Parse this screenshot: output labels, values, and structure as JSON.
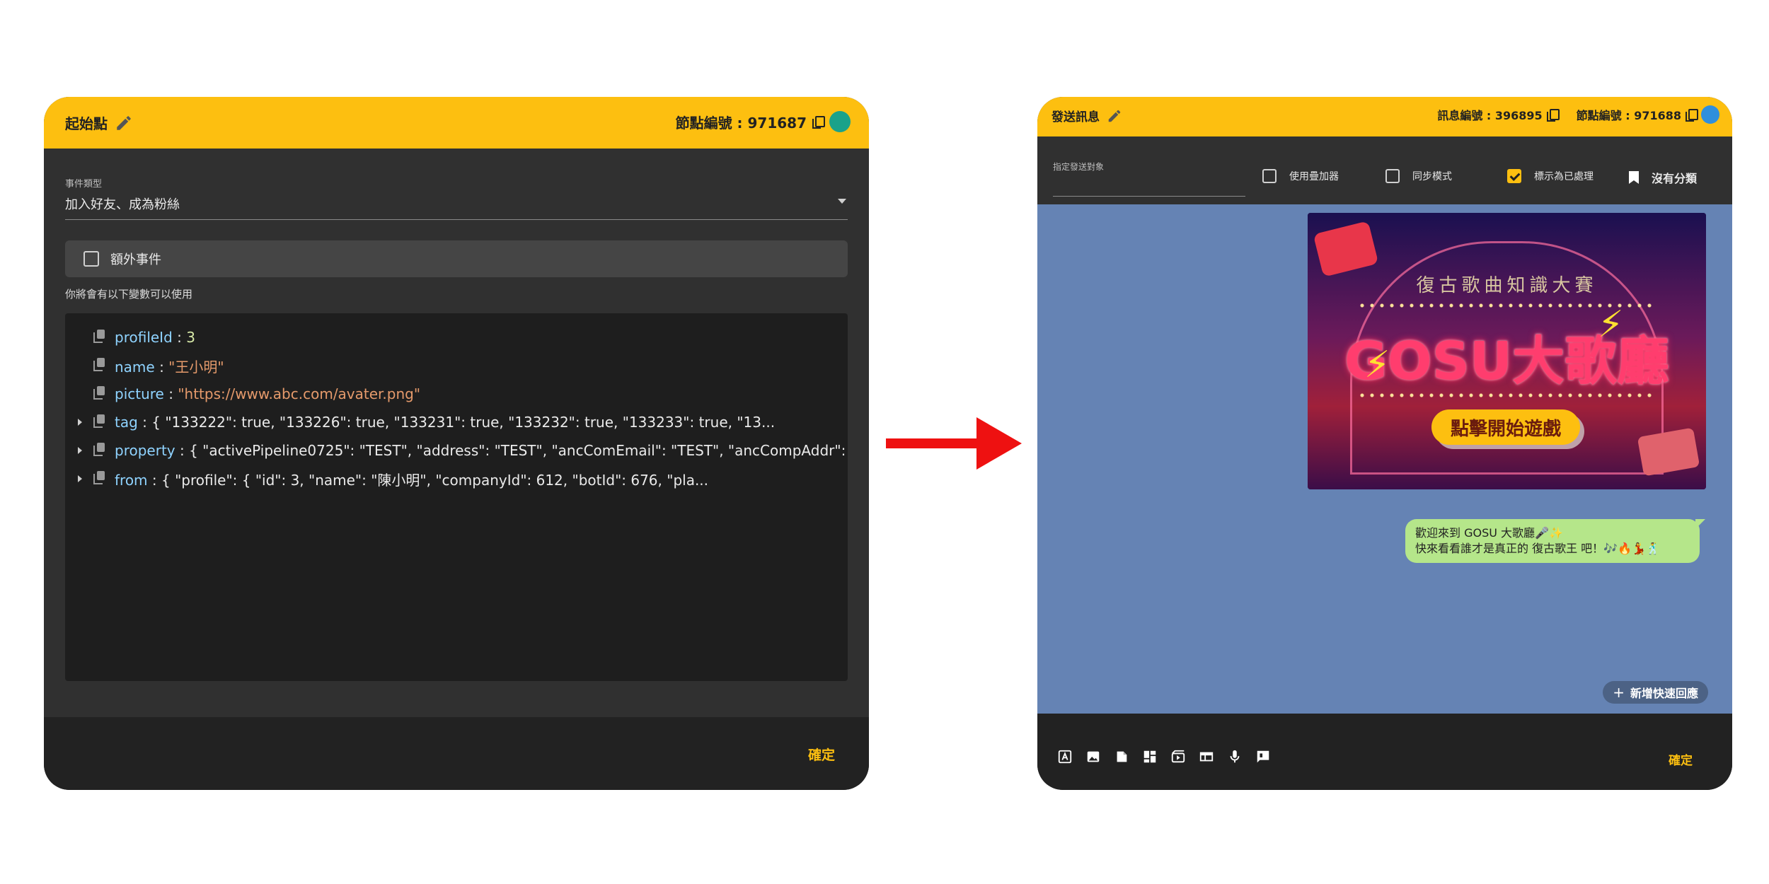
{
  "left_panel": {
    "title": "起始點",
    "node_label": "節點編號 : 971687",
    "event_type_label": "事件類型",
    "event_type_value": "加入好友、成為粉絲",
    "extra_event_label": "額外事件",
    "vars_hint": "你將會有以下變數可以使用",
    "vars": [
      {
        "key": "profileId",
        "sep": " : ",
        "value": "3",
        "kind": "num",
        "expandable": false
      },
      {
        "key": "name",
        "sep": " : ",
        "value": "\"王小明\"",
        "kind": "str",
        "expandable": false
      },
      {
        "key": "picture",
        "sep": " : ",
        "value": "\"https://www.abc.com/avater.png\"",
        "kind": "str",
        "expandable": false
      },
      {
        "key": "tag",
        "sep": " : ",
        "value": "{ \"133222\": true, \"133226\": true, \"133231\": true, \"133232\": true, \"133233\": true, \"13...",
        "kind": "obj",
        "expandable": true
      },
      {
        "key": "property",
        "sep": " : ",
        "value": "{ \"activePipeline0725\": \"TEST\", \"address\": \"TEST\", \"ancComEmail\": \"TEST\", \"ancCompAddr\": ...",
        "kind": "obj",
        "expandable": true
      },
      {
        "key": "from",
        "sep": " : ",
        "value": "{ \"profile\": { \"id\": 3, \"name\": \"陳小明\", \"companyId\": 612, \"botId\": 676, \"pla...",
        "kind": "obj",
        "expandable": true
      }
    ],
    "confirm_label": "確定"
  },
  "right_panel": {
    "title": "發送訊息",
    "message_label": "訊息編號 : 396895",
    "node_label": "節點編號 : 971688",
    "target_label": "指定發送對象",
    "options": [
      {
        "label": "使用疊加器",
        "checked": false
      },
      {
        "label": "同步模式",
        "checked": false
      },
      {
        "label": "標示為已處理",
        "checked": true
      }
    ],
    "category_label": "沒有分類",
    "banner": {
      "subtitle": "復古歌曲知識大賽",
      "main_title": "GOSU大歌廳",
      "button_label": "點擊開始遊戲"
    },
    "bubble_line1": "歡迎來到 GOSU 大歌廳🎤✨",
    "bubble_line2": "快來看看誰才是真正的 復古歌王 吧！🎶🔥💃🕺",
    "quick_reply_label": "新增快速回應",
    "confirm_label": "確定",
    "tools": [
      "text-icon",
      "image-icon",
      "sticker-icon",
      "imagemap-icon",
      "video-icon",
      "carousel-icon",
      "audio-icon",
      "flex-message-icon"
    ]
  },
  "colors": {
    "header": "#fdbf10",
    "chat_bg": "#6583b4",
    "bubble": "#b5e68a",
    "arrow": "#ee1111"
  }
}
